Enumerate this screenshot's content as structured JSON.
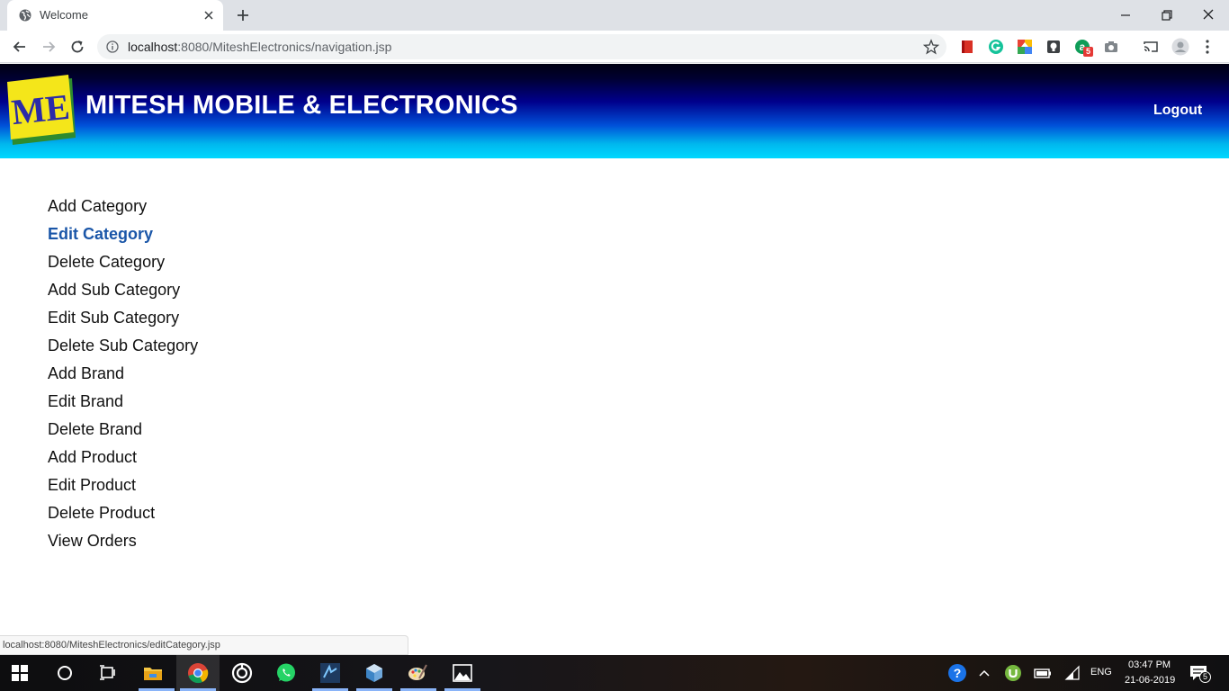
{
  "browser": {
    "tab_title": "Welcome",
    "url_host": "localhost",
    "url_rest": ":8080/MiteshElectronics/navigation.jsp",
    "extension_badge": "5"
  },
  "header": {
    "logo_text": "ME",
    "site_title": "MITESH MOBILE & ELECTRONICS",
    "logout_label": "Logout"
  },
  "nav": {
    "items": [
      {
        "label": "Add Category"
      },
      {
        "label": "Edit Category"
      },
      {
        "label": "Delete Category"
      },
      {
        "label": "Add Sub Category"
      },
      {
        "label": "Edit Sub Category"
      },
      {
        "label": "Delete Sub Category"
      },
      {
        "label": "Add Brand"
      },
      {
        "label": "Edit Brand"
      },
      {
        "label": "Delete Brand"
      },
      {
        "label": "Add Product"
      },
      {
        "label": "Edit Product"
      },
      {
        "label": "Delete Product"
      },
      {
        "label": "View Orders"
      }
    ],
    "active_item": "Edit Category"
  },
  "status_bar": {
    "hover_url": "localhost:8080/MiteshElectronics/editCategory.jsp"
  },
  "taskbar": {
    "language": "ENG",
    "time": "03:47 PM",
    "date": "21-06-2019",
    "notification_count": "5"
  },
  "colors": {
    "active_link": "#1a56a8",
    "header_top": "#000012",
    "header_bottom": "#00d8ff",
    "logo_yellow": "#f4e61a",
    "logo_green": "#2e8b2e",
    "logo_text_blue": "#2a2aa8"
  }
}
